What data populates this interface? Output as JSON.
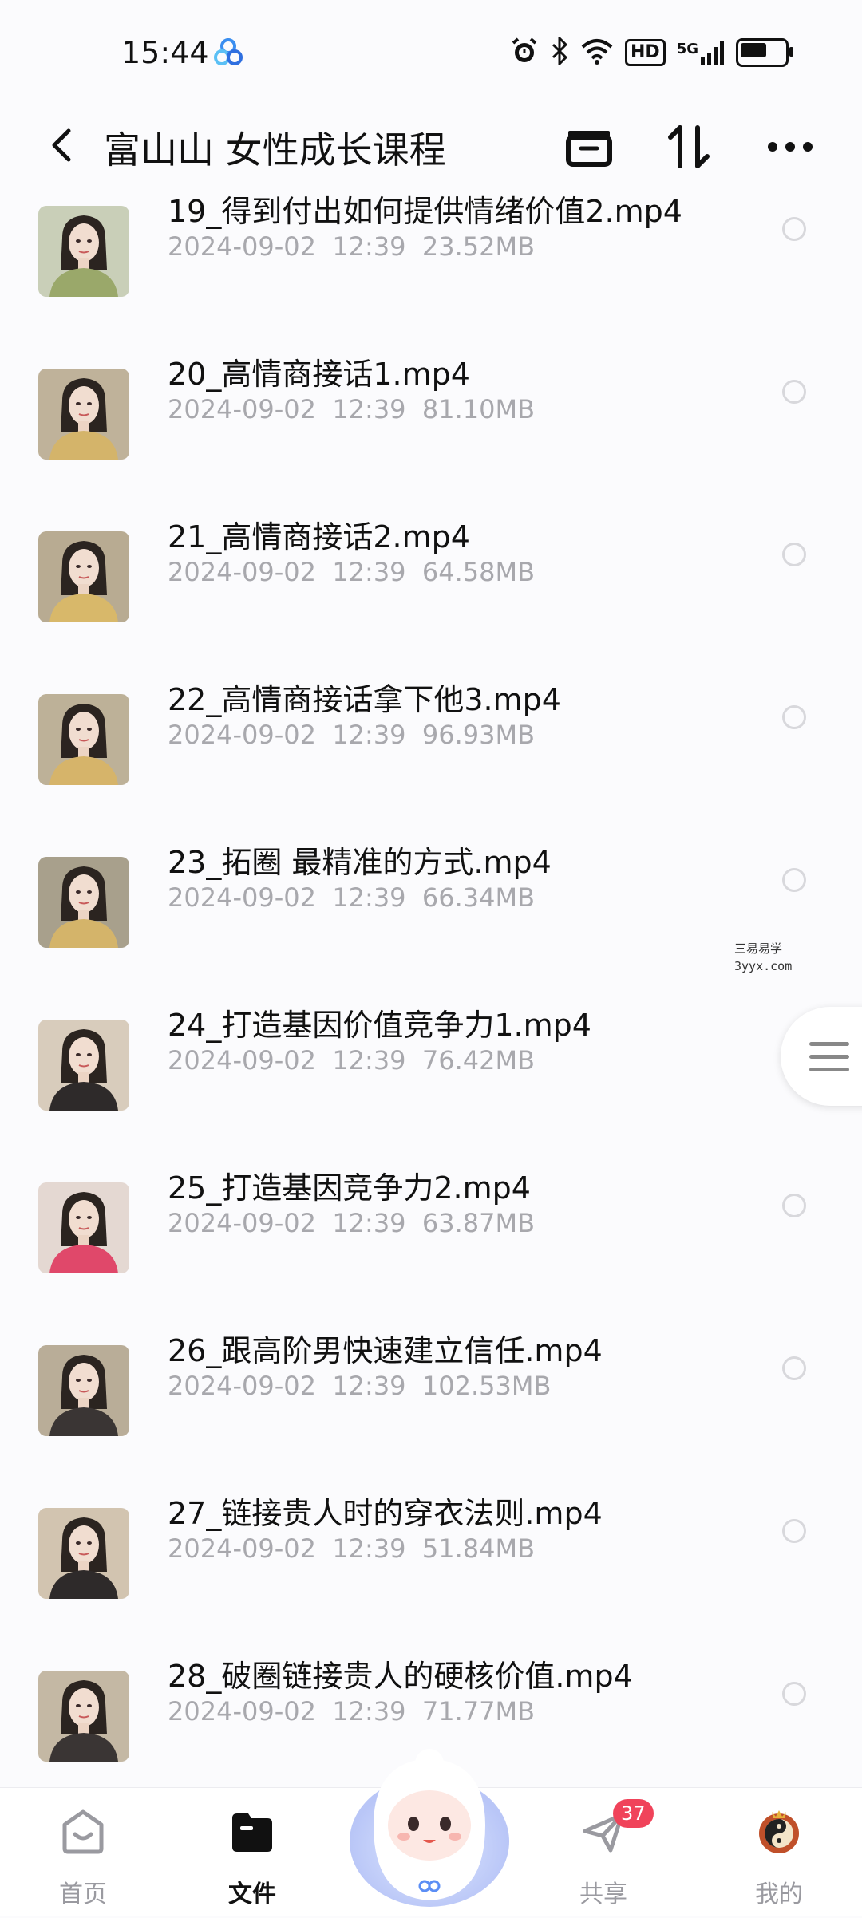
{
  "status_bar": {
    "time": "15:44",
    "hd_label": "HD",
    "network_label": "5G",
    "battery_level": 0.6,
    "icons": [
      "cloud-app-icon",
      "alarm-icon",
      "bluetooth-icon",
      "wifi-icon",
      "hd-icon",
      "signal-icon",
      "battery-icon"
    ]
  },
  "header": {
    "title": "富山山 女性成长课程",
    "actions": [
      "archive-icon",
      "sort-icon",
      "more-icon"
    ]
  },
  "files": [
    {
      "name": "19_得到付出如何提供情绪价值2.mp4",
      "date": "2024-09-02",
      "time": "12:39",
      "size": "23.52MB",
      "thumb_bg": "#c9cfb8",
      "shirt": "#9aa86a"
    },
    {
      "name": "20_高情商接话1.mp4",
      "date": "2024-09-02",
      "time": "12:39",
      "size": "81.10MB",
      "thumb_bg": "#bfb29a",
      "shirt": "#d4b46a"
    },
    {
      "name": "21_高情商接话2.mp4",
      "date": "2024-09-02",
      "time": "12:39",
      "size": "64.58MB",
      "thumb_bg": "#b8ab92",
      "shirt": "#d8b86a"
    },
    {
      "name": "22_高情商接话拿下他3.mp4",
      "date": "2024-09-02",
      "time": "12:39",
      "size": "96.93MB",
      "thumb_bg": "#bdb198",
      "shirt": "#d6b46a"
    },
    {
      "name": "23_拓圈 最精准的方式.mp4",
      "date": "2024-09-02",
      "time": "12:39",
      "size": "66.34MB",
      "thumb_bg": "#a8a08c",
      "shirt": "#d4b46a"
    },
    {
      "name": "24_打造基因价值竞争力1.mp4",
      "date": "2024-09-02",
      "time": "12:39",
      "size": "76.42MB",
      "thumb_bg": "#d8ccbc",
      "shirt": "#2e2a2a"
    },
    {
      "name": "25_打造基因竞争力2.mp4",
      "date": "2024-09-02",
      "time": "12:39",
      "size": "63.87MB",
      "thumb_bg": "#e4d8d2",
      "shirt": "#e0486a"
    },
    {
      "name": "26_跟高阶男快速建立信任.mp4",
      "date": "2024-09-02",
      "time": "12:39",
      "size": "102.53MB",
      "thumb_bg": "#b9ad98",
      "shirt": "#3a3534"
    },
    {
      "name": "27_链接贵人时的穿衣法则.mp4",
      "date": "2024-09-02",
      "time": "12:39",
      "size": "51.84MB",
      "thumb_bg": "#d2c4b0",
      "shirt": "#2e2a2a"
    },
    {
      "name": "28_破圈链接贵人的硬核价值.mp4",
      "date": "2024-09-02",
      "time": "12:39",
      "size": "71.77MB",
      "thumb_bg": "#c4b8a4",
      "shirt": "#3a3534"
    }
  ],
  "watermark": {
    "line1": "三易易学",
    "line2": "3yyx.com"
  },
  "bottom_nav": {
    "items": [
      {
        "label": "首页",
        "icon": "home-icon",
        "active": false
      },
      {
        "label": "文件",
        "icon": "folder-icon",
        "active": true
      },
      {
        "label": "共享",
        "icon": "share-icon",
        "active": false,
        "badge": "37"
      },
      {
        "label": "我的",
        "icon": "avatar-icon",
        "active": false
      }
    ]
  },
  "colors": {
    "text_primary": "#111111",
    "text_secondary": "#a8a8ad",
    "badge": "#f0435a",
    "nav_inactive": "#9a9aa0"
  }
}
